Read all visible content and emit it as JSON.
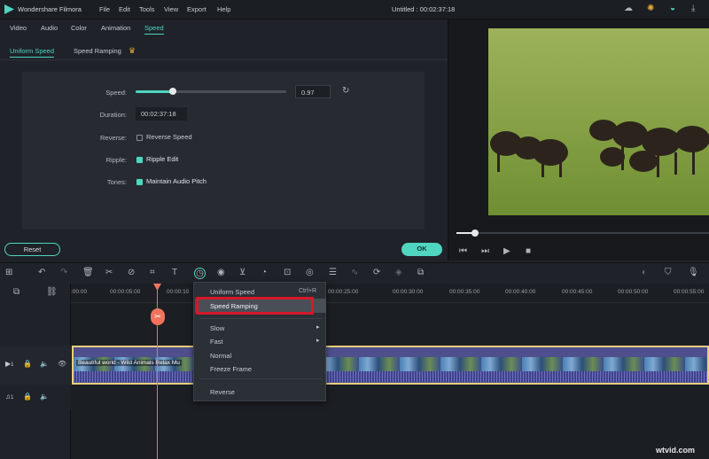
{
  "app": {
    "name": "Wondershare Filmora",
    "title": "Untitled : 00:02:37:18",
    "menu": [
      "File",
      "Edit",
      "Tools",
      "View",
      "Export",
      "Help"
    ]
  },
  "tabs": [
    "Video",
    "Audio",
    "Color",
    "Animation",
    "Speed"
  ],
  "subtabs": {
    "uniform": "Uniform Speed",
    "ramping": "Speed Ramping"
  },
  "speed": {
    "label": "Speed:",
    "value": "0.97",
    "slider_fraction": 0.25
  },
  "duration": {
    "label": "Duration:",
    "value": "00:02:37:18"
  },
  "reverse": {
    "label": "Reverse:",
    "text": "Reverse Speed",
    "checked": false
  },
  "ripple": {
    "label": "Ripple:",
    "text": "Ripple Edit",
    "checked": true
  },
  "tones": {
    "label": "Tones:",
    "text": "Maintain Audio Pitch",
    "checked": true
  },
  "buttons": {
    "reset": "Reset",
    "ok": "OK"
  },
  "player": {
    "progress": 0.05
  },
  "timeline": {
    "ticks": [
      ":00:00",
      "00:00:05:00",
      "00:00:10",
      "00:00:25:00",
      "00:00:30:00",
      "00:00:35:00",
      "00:00:40:00",
      "00:00:45:00",
      "00:00:50:00",
      "00:00:55:00"
    ],
    "clip_title": "Beautiful world - Wild Animals Relax Mu",
    "video_track": "1",
    "audio_track": "1"
  },
  "context_menu": {
    "items": [
      {
        "label": "Uniform Speed",
        "shortcut": "Ctrl+R"
      },
      {
        "label": "Speed Ramping",
        "shortcut": ""
      },
      {
        "label": "Slow",
        "shortcut": "▸"
      },
      {
        "label": "Fast",
        "shortcut": "▸"
      },
      {
        "label": "Normal",
        "shortcut": ""
      },
      {
        "label": "Freeze Frame",
        "shortcut": ""
      },
      {
        "label": "Reverse",
        "shortcut": ""
      }
    ]
  },
  "watermark": "wtvid.com",
  "colors": {
    "accent": "#4fd5c0",
    "highlight": "#d4192a"
  }
}
